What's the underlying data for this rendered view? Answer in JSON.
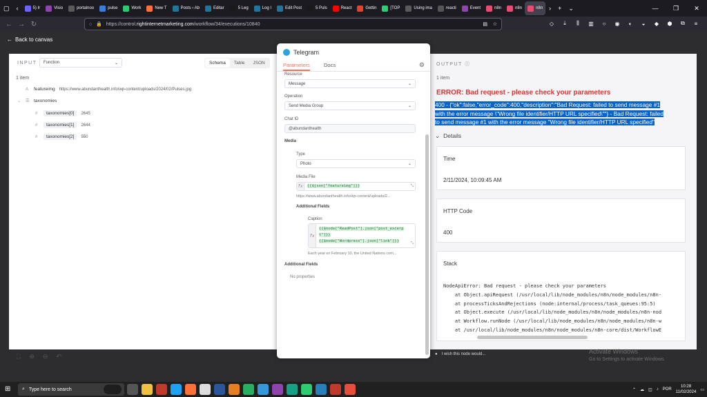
{
  "browser": {
    "tabs": [
      {
        "label": "5) Ir",
        "color": "#6c63ff"
      },
      {
        "label": "Visio",
        "color": "#8e44ad"
      },
      {
        "label": "portalnoo",
        "color": "#5a5a5a"
      },
      {
        "label": "pulse",
        "color": "#3b7ddd"
      },
      {
        "label": "Work",
        "color": "#2ecc71"
      },
      {
        "label": "New T",
        "color": "#ff7139"
      },
      {
        "label": "Posts ‹ Ab",
        "color": "#21759b"
      },
      {
        "label": "Editar",
        "color": "#21759b"
      },
      {
        "label": "5 Leg",
        "color": "#1a1a1a"
      },
      {
        "label": "Log I",
        "color": "#21759b"
      },
      {
        "label": "Edit Post",
        "color": "#21759b"
      },
      {
        "label": "5 Puls",
        "color": "#1a1a1a"
      },
      {
        "label": "React",
        "color": "#ff0000"
      },
      {
        "label": "Gettin",
        "color": "#e24329"
      },
      {
        "label": "[TOP",
        "color": "#2ecc71"
      },
      {
        "label": "Using ima",
        "color": "#5a5a5a"
      },
      {
        "label": "reacti",
        "color": "#555555"
      },
      {
        "label": "Event",
        "color": "#8e44ad"
      },
      {
        "label": "n8n",
        "color": "#ea4b71"
      },
      {
        "label": "n8n",
        "color": "#ea4b71"
      },
      {
        "label": "n8n",
        "color": "#ea4b71"
      }
    ],
    "url_prefix": "https://control.",
    "url_domain": "rightinternetmarketing.com",
    "url_path": "/workflow/34/executions/10840"
  },
  "app": {
    "back_label": "Back to canvas",
    "input": {
      "header": "INPUT",
      "node_select": "Function",
      "views": [
        "Schema",
        "Table",
        "JSON"
      ],
      "count": "1 item",
      "rows": [
        {
          "type": "A",
          "key": "featureimg",
          "value": "https://www.abundanthealth.info/wp-content/uploads/2024/02/Pulses.jpg"
        },
        {
          "type": "☰",
          "key": "taxonomies",
          "value": ""
        },
        {
          "type": "#",
          "key": "taxonomies[0]",
          "value": "2645"
        },
        {
          "type": "#",
          "key": "taxonomies[1]",
          "value": "2644"
        },
        {
          "type": "#",
          "key": "taxonomies[2]",
          "value": "550"
        }
      ]
    },
    "node": {
      "title": "Telegram",
      "tabs": [
        "Parameters",
        "Docs"
      ],
      "resource_label": "Resource",
      "resource_value": "Message",
      "operation_label": "Operation",
      "operation_value": "Send Media Group",
      "chat_label": "Chat ID",
      "chat_value": "@abundanthealth",
      "media_label": "Media",
      "type_label": "Type",
      "type_value": "Photo",
      "media_file_label": "Media File",
      "media_file_expr": "{{$json[\"featureimg\"]}}",
      "media_file_preview": "https://www.abundanthealth.info/wp-content/uploads/2...",
      "additional_fields_label": "Additional Fields",
      "caption_label": "Caption",
      "caption_line1": "{{$node[\"ReadPost\"].json[\"post_excerp",
      "caption_line2": "t\"]}}",
      "caption_line3": "{{$node[\"Wordpress\"].json[\"link\"]}}",
      "caption_preview": "Each year on February 10, the United Nations com...",
      "additional_fields2_label": "Additional Fields",
      "no_properties": "No properties",
      "feedback": "I wish this node would..."
    },
    "output": {
      "header": "OUTPUT",
      "count": "1 item",
      "error_title": "ERROR: Bad request - please check your parameters",
      "error_lines": [
        "400 - {\"ok\":false,\"error_code\":400,\"description\":\"Bad Request: failed to send message #1",
        "with the error message \\\"Wrong file identifier/HTTP URL specified\\\"\"} - Bad Request: failed",
        "to send message #1 with the error message \"Wrong file identifier/HTTP URL specified\""
      ],
      "details_label": "Details",
      "time_label": "Time",
      "time_value": "2/11/2024, 10:09:45 AM",
      "http_label": "HTTP Code",
      "http_value": "400",
      "stack_label": "Stack",
      "stack_lines": [
        "NodeApiError: Bad request - please check your parameters",
        "    at Object.apiRequest (/usr/local/lib/node_modules/n8n/node_modules/n8n-",
        "    at processTicksAndRejections (node:internal/process/task_queues:95:5)",
        "    at Object.execute (/usr/local/lib/node_modules/n8n/node_modules/n8n-nod",
        "    at Workflow.runNode (/usr/local/lib/node_modules/n8n/node_modules/n8n-w",
        "    at /usr/local/lib/node_modules/n8n/node_modules/n8n-core/dist/WorkflowE"
      ]
    }
  },
  "windows": {
    "activate_title": "Activate Windows",
    "activate_sub": "Go to Settings to activate Windows.",
    "search_placeholder": "Type here to search",
    "lang": "POR",
    "time": "10:28",
    "date": "11/02/2024"
  },
  "colors": {
    "accent": "#ff6d5a",
    "error": "#e23030",
    "telegram": "#2aa3df",
    "highlight": "#0a64c8"
  }
}
